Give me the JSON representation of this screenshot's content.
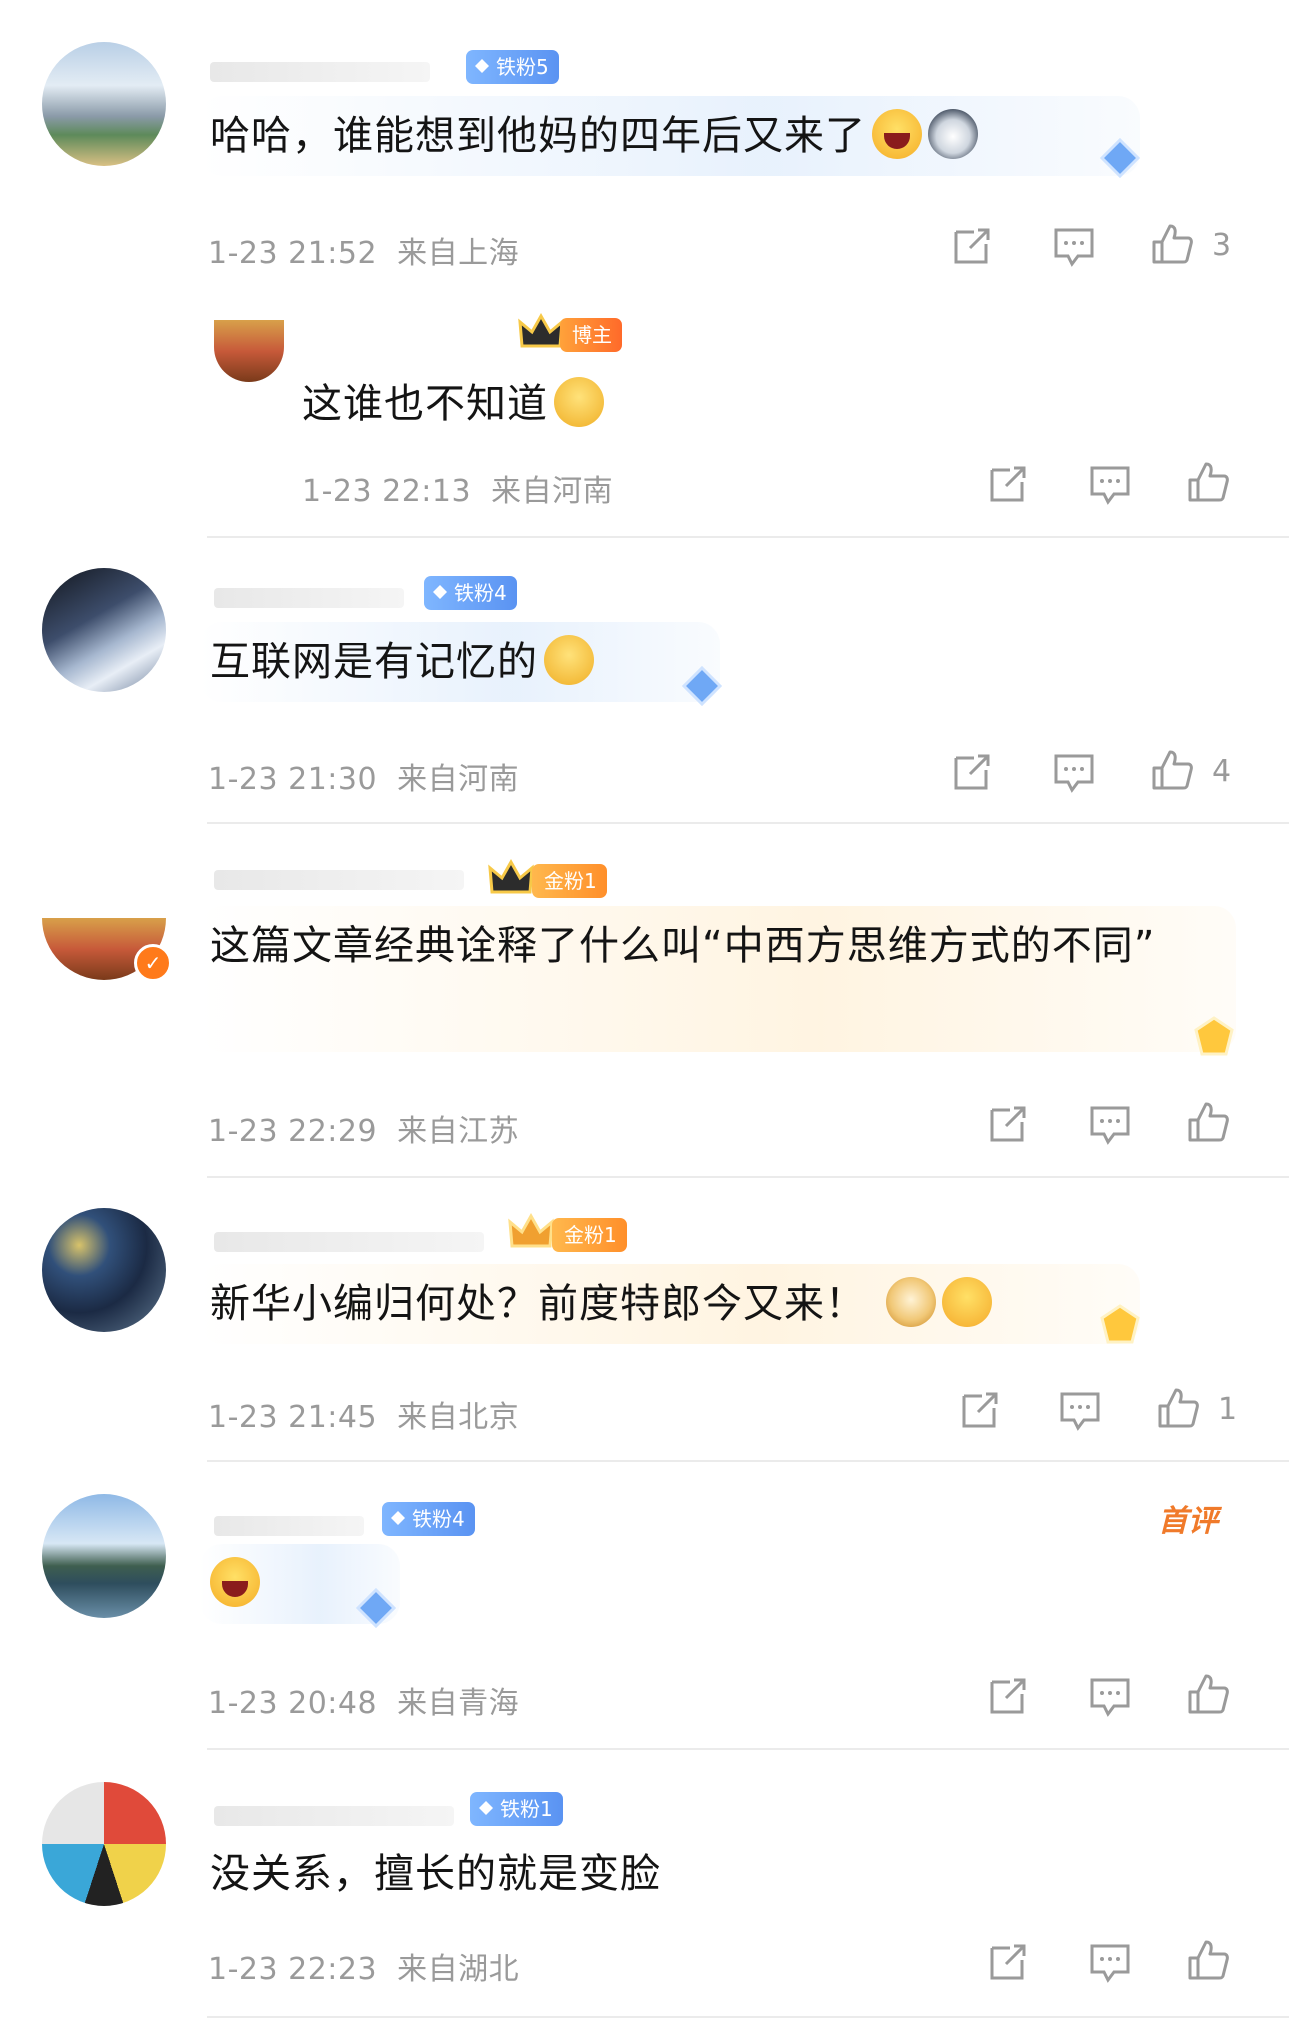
{
  "comments": [
    {
      "badge": "铁粉5",
      "text": "哈哈，谁能想到他妈的四年后又来了",
      "emojis": [
        "laugh-emoji",
        "husky-emoji"
      ],
      "time": "1-23 21:52",
      "location": "来自上海",
      "likes": "3"
    },
    {
      "badge": "博主",
      "text": "这谁也不知道",
      "emojis": [
        "think-emoji"
      ],
      "time": "1-23 22:13",
      "location": "来自河南",
      "likes": ""
    },
    {
      "badge": "铁粉4",
      "text": "互联网是有记忆的",
      "emojis": [
        "smug-emoji"
      ],
      "time": "1-23 21:30",
      "location": "来自河南",
      "likes": "4"
    },
    {
      "badge": "金粉1",
      "text": "这篇文章经典诠释了什么叫“中西方思维方式的不同”",
      "emojis": [],
      "time": "1-23 22:29",
      "location": "来自江苏",
      "likes": ""
    },
    {
      "badge": "金粉1",
      "text": "新华小编归何处？前度特郎今又来！",
      "emojis": [
        "doge-emoji",
        "grin-emoji"
      ],
      "time": "1-23 21:45",
      "location": "来自北京",
      "likes": "1"
    },
    {
      "badge": "铁粉4",
      "text": "",
      "emojis": [
        "laugh-emoji"
      ],
      "time": "1-23 20:48",
      "location": "来自青海",
      "likes": "",
      "tag": "首评"
    },
    {
      "badge": "铁粉1",
      "text": "没关系，擅长的就是变脸",
      "emojis": [],
      "time": "1-23 22:23",
      "location": "来自湖北",
      "likes": ""
    }
  ],
  "colors": {
    "meta_gray": "#9a9a9a",
    "blue_badge": "#5a93f2",
    "gold_badge": "#ff8f2a",
    "first_tag": "#f07a2a"
  }
}
